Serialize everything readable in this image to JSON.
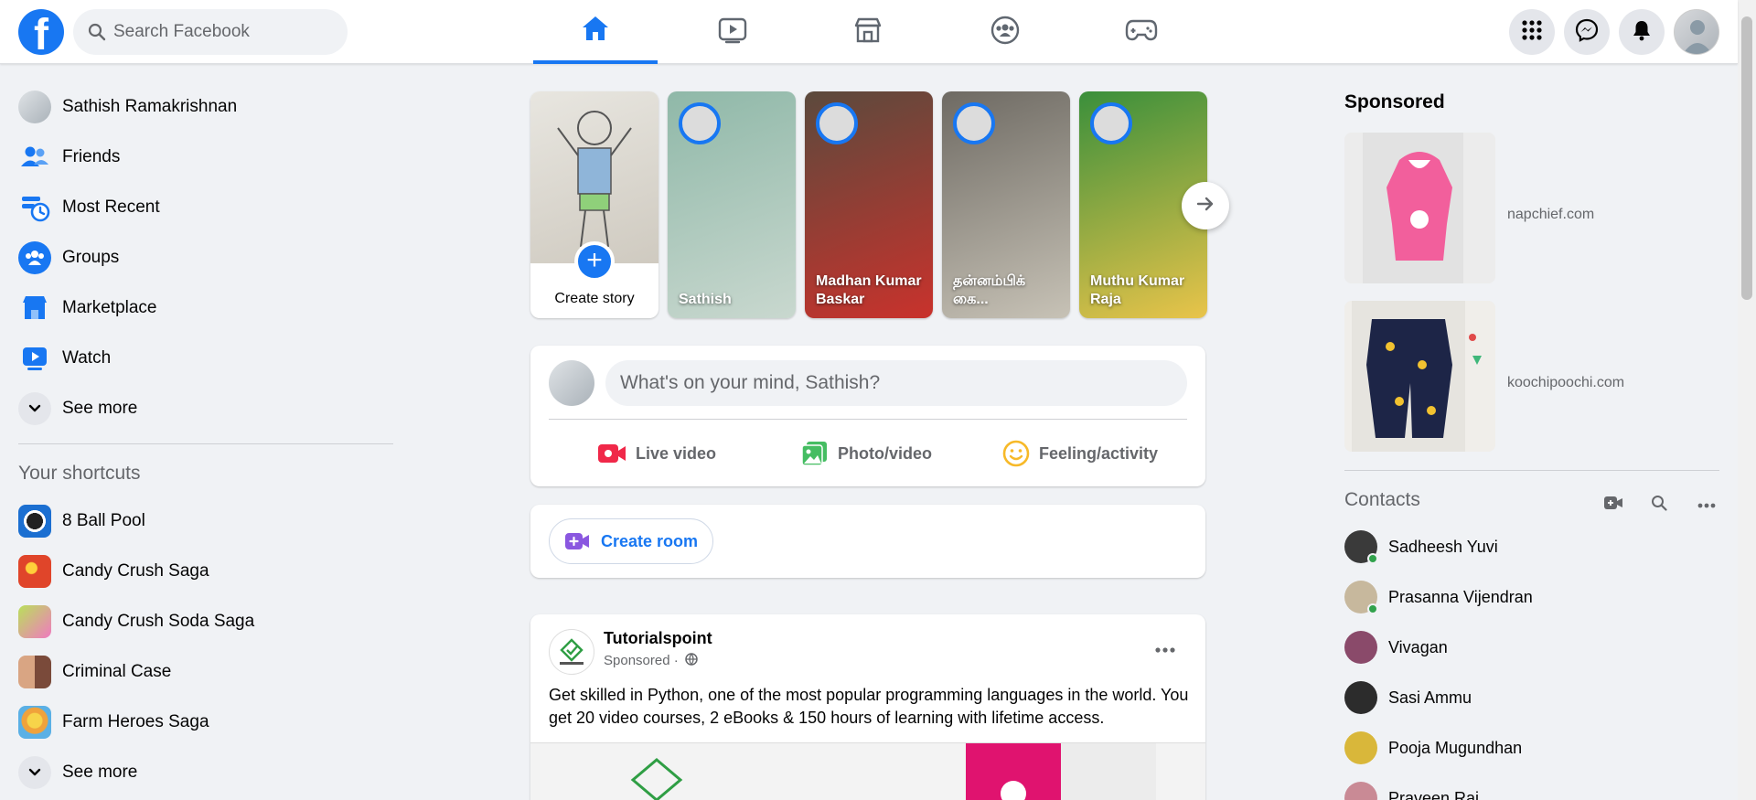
{
  "header": {
    "search_placeholder": "Search Facebook",
    "logo_letter": "f",
    "nav_tabs": [
      {
        "name": "home",
        "icon": "home-icon",
        "active": true
      },
      {
        "name": "watch",
        "icon": "video-icon",
        "active": false
      },
      {
        "name": "marketplace",
        "icon": "store-icon",
        "active": false
      },
      {
        "name": "groups",
        "icon": "groups-icon",
        "active": false
      },
      {
        "name": "gaming",
        "icon": "gamepad-icon",
        "active": false
      }
    ],
    "right_buttons": [
      "menu-grid-icon",
      "messenger-icon",
      "bell-icon",
      "profile-avatar"
    ]
  },
  "sidebar": {
    "items": [
      {
        "label": "Sathish Ramakrishnan",
        "icon": "profile-avatar"
      },
      {
        "label": "Friends",
        "icon": "friends-icon"
      },
      {
        "label": "Most Recent",
        "icon": "clock-icon"
      },
      {
        "label": "Groups",
        "icon": "groups-icon"
      },
      {
        "label": "Marketplace",
        "icon": "store-icon"
      },
      {
        "label": "Watch",
        "icon": "video-icon"
      },
      {
        "label": "See more",
        "icon": "chevron-down-icon"
      }
    ],
    "shortcuts_title": "Your shortcuts",
    "shortcuts": [
      {
        "label": "8 Ball Pool",
        "color": "#1b6fd1"
      },
      {
        "label": "Candy Crush Saga",
        "color": "#e0452a"
      },
      {
        "label": "Candy Crush Soda Saga",
        "color": "#7fbf3a"
      },
      {
        "label": "Criminal Case",
        "color": "#b35a3c"
      },
      {
        "label": "Farm Heroes Saga",
        "color": "#f0a23b"
      },
      {
        "label": "See more",
        "color": "#e4e6eb"
      }
    ]
  },
  "stories": {
    "create_label": "Create story",
    "items": [
      {
        "name": "Sathish",
        "colors": [
          "#8fb8a8",
          "#c9d8cf"
        ]
      },
      {
        "name": "Madhan Kumar Baskar",
        "colors": [
          "#5b4a3d",
          "#c9322c"
        ]
      },
      {
        "name": "தன்னம்பிக் கை...",
        "colors": [
          "#6e6a63",
          "#c7c2b6"
        ]
      },
      {
        "name": "Muthu Kumar Raja",
        "colors": [
          "#3a8f3b",
          "#e9c44a"
        ]
      }
    ]
  },
  "composer": {
    "placeholder": "What's on your mind, Sathish?",
    "actions": [
      {
        "label": "Live video",
        "icon": "live-video-icon",
        "color": "#f02849"
      },
      {
        "label": "Photo/video",
        "icon": "photo-icon",
        "color": "#45bd62"
      },
      {
        "label": "Feeling/activity",
        "icon": "feeling-icon",
        "color": "#f7b928"
      }
    ]
  },
  "room": {
    "label": "Create room"
  },
  "post": {
    "page_name": "Tutorialspoint",
    "sponsored": "Sponsored ·",
    "body": "Get skilled in Python, one of the most popular programming languages in the world. You get 20 video courses, 2 eBooks & 150 hours of learning with lifetime access."
  },
  "right": {
    "sponsored_title": "Sponsored",
    "ads": [
      {
        "domain": "napchief.com",
        "color": "#f25f9c"
      },
      {
        "domain": "koochipoochi.com",
        "color": "#1d2547"
      }
    ],
    "contacts_title": "Contacts",
    "contacts": [
      {
        "name": "Sadheesh Yuvi",
        "online": true,
        "color": "#3a3a3a"
      },
      {
        "name": "Prasanna Vijendran",
        "online": true,
        "color": "#c7b89d"
      },
      {
        "name": "Vivagan",
        "online": false,
        "color": "#8a4a6a"
      },
      {
        "name": "Sasi Ammu",
        "online": false,
        "color": "#2c2c2c"
      },
      {
        "name": "Pooja Mugundhan",
        "online": false,
        "color": "#d9b73a"
      },
      {
        "name": "Praveen Raj",
        "online": false,
        "color": "#c98a95"
      }
    ]
  }
}
